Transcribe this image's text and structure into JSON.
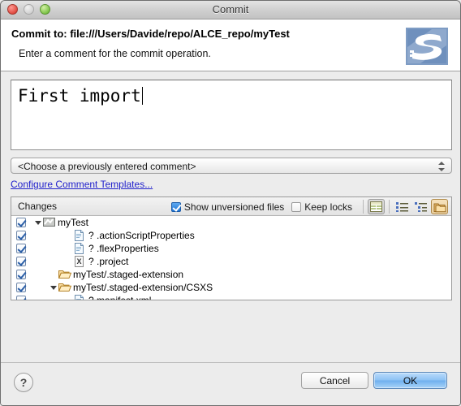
{
  "window": {
    "title": "Commit",
    "traffic_lights": [
      "close",
      "minimize",
      "maximize"
    ]
  },
  "header": {
    "title": "Commit to: file:///Users/Davide/repo/ALCE_repo/myTest",
    "subtitle": "Enter a comment for the commit operation.",
    "logo_name": "subversion-logo"
  },
  "comment": {
    "value": "First import",
    "combo_selected": "<Choose a previously entered comment>",
    "templates_link": "Configure Comment Templates..."
  },
  "changes": {
    "label": "Changes",
    "show_unversioned": {
      "label": "Show unversioned files",
      "checked": true
    },
    "keep_locks": {
      "label": "Keep locks",
      "checked": false
    },
    "toolbar": [
      {
        "name": "table-view-button",
        "state": "pressed"
      },
      {
        "name": "flat-list-button",
        "state": "normal"
      },
      {
        "name": "tree-list-button",
        "state": "normal"
      },
      {
        "name": "compressed-folders-button",
        "state": "active"
      }
    ],
    "rows": [
      {
        "label": "myTest",
        "icon": "project-icon",
        "indent": 0,
        "twisty": "open",
        "checked": true,
        "marker": ""
      },
      {
        "label": ".actionScriptProperties",
        "icon": "file-icon",
        "indent": 2,
        "twisty": "none",
        "checked": true,
        "marker": "?"
      },
      {
        "label": ".flexProperties",
        "icon": "file-icon",
        "indent": 2,
        "twisty": "none",
        "checked": true,
        "marker": "?"
      },
      {
        "label": ".project",
        "icon": "xml-file-icon",
        "indent": 2,
        "twisty": "none",
        "checked": true,
        "marker": "?"
      },
      {
        "label": "myTest/.staged-extension",
        "icon": "folder-icon",
        "indent": 1,
        "twisty": "none",
        "checked": true,
        "marker": ""
      },
      {
        "label": "myTest/.staged-extension/CSXS",
        "icon": "folder-icon",
        "indent": 1,
        "twisty": "open",
        "checked": true,
        "marker": ""
      },
      {
        "label": "manifest.xml",
        "icon": "file-icon",
        "indent": 2,
        "twisty": "none",
        "checked": true,
        "marker": "?"
      }
    ]
  },
  "footer": {
    "help_label": "?",
    "cancel_label": "Cancel",
    "ok_label": "OK"
  }
}
